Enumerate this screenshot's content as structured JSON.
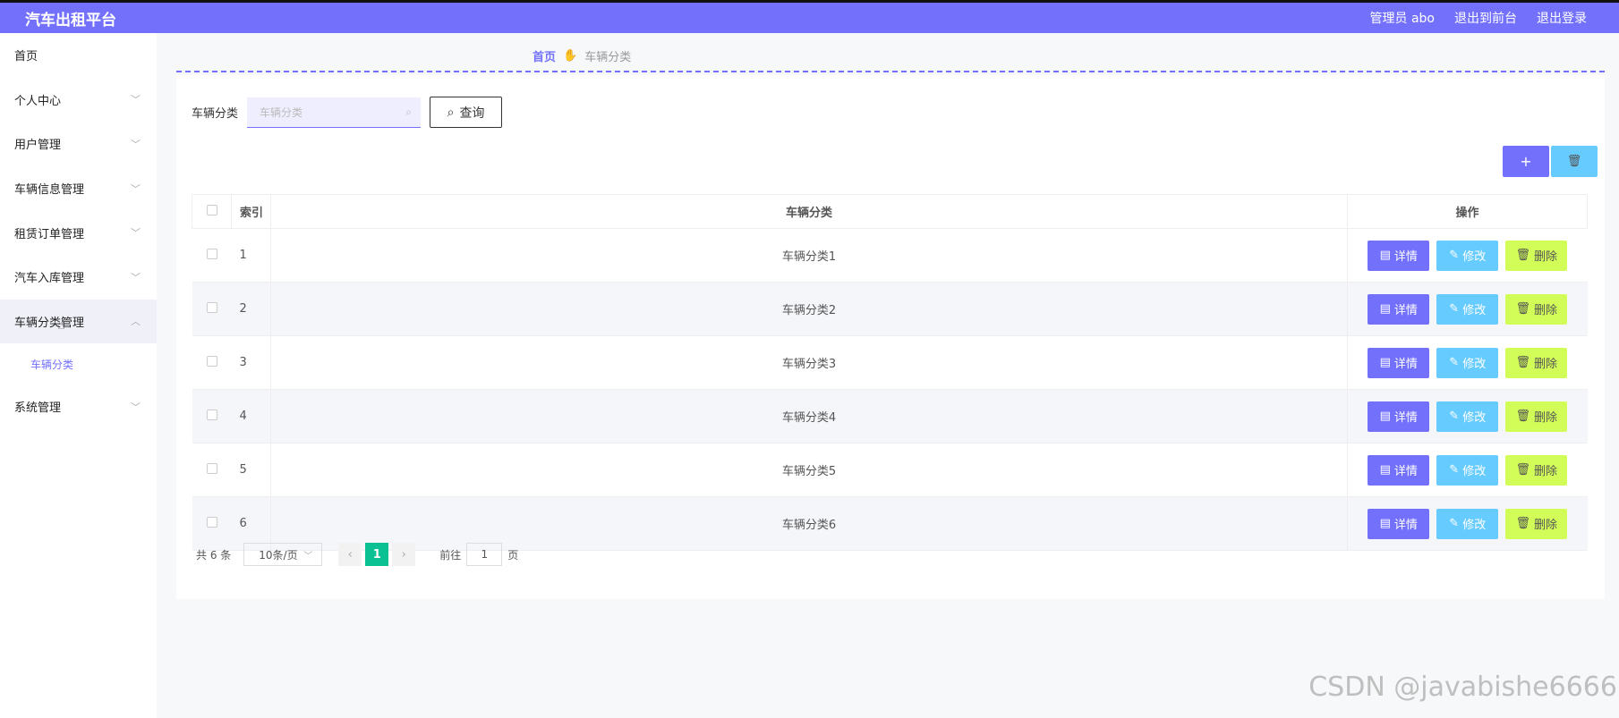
{
  "header": {
    "brand": "汽车出租平台",
    "nav": [
      "管理员 abo",
      "退出到前台",
      "退出登录"
    ]
  },
  "sidebar": {
    "items": [
      {
        "label": "首页"
      },
      {
        "label": "个人中心"
      },
      {
        "label": "用户管理"
      },
      {
        "label": "车辆信息管理"
      },
      {
        "label": "租赁订单管理"
      },
      {
        "label": "汽车入库管理"
      },
      {
        "label": "车辆分类管理"
      },
      {
        "label": "系统管理"
      }
    ],
    "submenu": "车辆分类"
  },
  "breadcrumb": {
    "home": "首页",
    "current": "车辆分类"
  },
  "search": {
    "label": "车辆分类",
    "placeholder": "车辆分类",
    "button": "查询"
  },
  "toolbar": {
    "add": "+",
    "delete": "🗑"
  },
  "table": {
    "headers": [
      "索引",
      "车辆分类",
      "操作"
    ],
    "rows": [
      {
        "idx": "1",
        "name": "车辆分类1"
      },
      {
        "idx": "2",
        "name": "车辆分类2"
      },
      {
        "idx": "3",
        "name": "车辆分类3"
      },
      {
        "idx": "4",
        "name": "车辆分类4"
      },
      {
        "idx": "5",
        "name": "车辆分类5"
      },
      {
        "idx": "6",
        "name": "车辆分类6"
      }
    ],
    "ops": {
      "detail": "详情",
      "edit": "修改",
      "delete": "删除"
    }
  },
  "pagination": {
    "total": "共 6 条",
    "page_size": "10条/页",
    "current": "1",
    "goto": "前往",
    "goto_value": "1",
    "page_unit": "页"
  },
  "watermark": "CSDN @javabishe6666"
}
